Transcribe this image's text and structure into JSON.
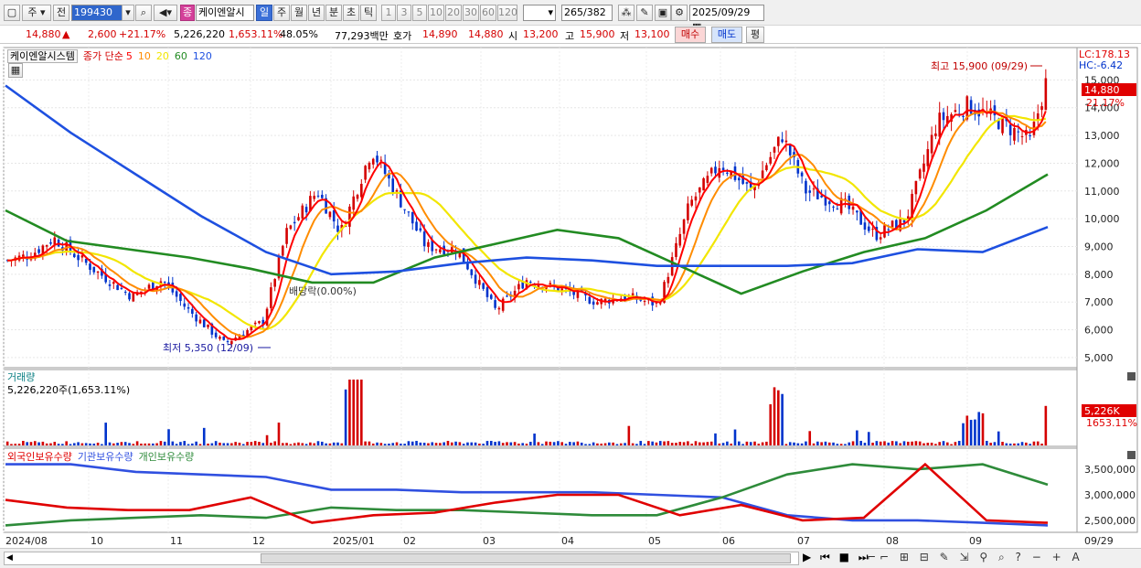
{
  "toolbar": {
    "type_select": "주",
    "prev_label": "전",
    "stock_code": "199430",
    "sound_icon": "speaker-icon",
    "stock_badge": "종",
    "stock_name": "케이엔알시",
    "periods": [
      "일",
      "주",
      "월",
      "년",
      "분",
      "초",
      "틱"
    ],
    "active_period": "일",
    "minutes": [
      "1",
      "3",
      "5",
      "10",
      "20",
      "30",
      "60",
      "120"
    ],
    "count": "265",
    "total": "/382",
    "date": "2025/09/29"
  },
  "quote": {
    "price": "14,880",
    "change_arrow": "▲",
    "change": "2,600",
    "change_pct": "+21.17%",
    "volume": "5,226,220",
    "volume_pct": "1,653.11%",
    "turnover_rate": "48.05%",
    "amount": "77,293백만",
    "hoga_label": "호가",
    "ask": "14,890",
    "bid": "14,880",
    "open_label": "시",
    "open": "13,200",
    "high_label": "고",
    "high": "15,900",
    "low_label": "저",
    "low": "13,100",
    "buy_label": "매수",
    "sell_label": "매도",
    "eval_label": "평"
  },
  "price_pane": {
    "stock_label": "케이엔알시스템",
    "ma_title": "종가 단순",
    "ma_periods": [
      "5",
      "10",
      "20",
      "60",
      "120"
    ],
    "ma_colors": [
      "#ff0000",
      "#ff8c00",
      "#f2e600",
      "#228b22",
      "#1e50e0"
    ],
    "lc_label": "LC:178.13",
    "hc_label": "HC:-6.42",
    "high_annotation": "최고 15,900 (09/29)",
    "low_annotation": "최저 5,350 (12/09)",
    "dividend_annotation": "배당락(0.00%)",
    "current_price_tag": "14,880",
    "current_pct_tag": "21.17%",
    "y_ticks": [
      "15,000",
      "14,000",
      "13,000",
      "12,000",
      "11,000",
      "10,000",
      "9,000",
      "8,000",
      "7,000",
      "6,000",
      "5,000"
    ]
  },
  "volume_pane": {
    "title": "거래량",
    "value_label": "5,226,220주(1,653.11%)",
    "current_tag": "5,226K",
    "current_pct_tag": "1653.11%"
  },
  "holding_pane": {
    "series": [
      "외국인보유수량",
      "기관보유수량",
      "개인보유수량"
    ],
    "colors": [
      "#e00000",
      "#3050e0",
      "#2e8b3a"
    ],
    "y_ticks": [
      "3,500,000",
      "3,000,000",
      "2,500,000"
    ]
  },
  "x_axis": [
    "2024/08",
    "10",
    "11",
    "12",
    "2025/01",
    "02",
    "03",
    "04",
    "05",
    "06",
    "07",
    "08",
    "09",
    "09/29"
  ],
  "colors": {
    "up": "#d40000",
    "down": "#0033cc",
    "toolbar_bg": "#f0f0f0"
  },
  "chart_data": {
    "type": "candlestick",
    "price_range": [
      4700,
      16100
    ],
    "ma120": [
      14800,
      13100,
      11600,
      10100,
      8800,
      8000,
      8100,
      8400,
      8600,
      8500,
      8300,
      8300,
      8300,
      8400,
      8900,
      8800,
      9700
    ],
    "ma60": [
      10300,
      9200,
      8900,
      8600,
      8200,
      7700,
      7700,
      8600,
      9100,
      9600,
      9300,
      8300,
      7300,
      8100,
      8800,
      9300,
      10300,
      11600
    ],
    "volume_spikes": [
      {
        "x": "2025/01",
        "value": 1.0
      },
      {
        "x": "07",
        "value": 0.8
      },
      {
        "x": "09/29",
        "value": 0.6
      }
    ],
    "holdings": {
      "foreign": [
        2900000,
        2750000,
        2700000,
        2700000,
        2950000,
        2450000,
        2600000,
        2650000,
        2850000,
        3000000,
        3000000,
        2600000,
        2800000,
        2500000,
        2550000,
        3600000,
        2500000,
        2450000
      ],
      "institution": [
        3600000,
        3600000,
        3450000,
        3400000,
        3350000,
        3100000,
        3100000,
        3050000,
        3050000,
        3050000,
        3000000,
        2950000,
        2600000,
        2500000,
        2500000,
        2450000,
        2400000
      ],
      "individual": [
        2400000,
        2500000,
        2550000,
        2600000,
        2550000,
        2750000,
        2700000,
        2700000,
        2650000,
        2600000,
        2600000,
        2950000,
        3400000,
        3600000,
        3500000,
        3600000,
        3200000
      ]
    }
  }
}
